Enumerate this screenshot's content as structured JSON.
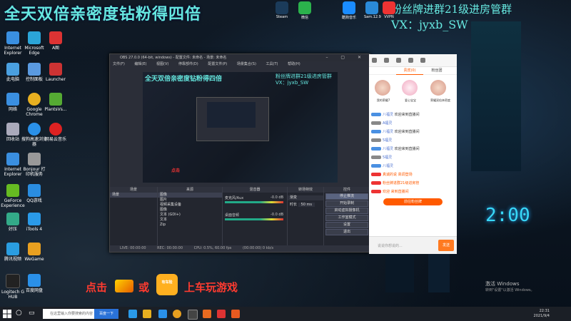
{
  "overlay": {
    "title": "全天双倍亲密度钻粉得四倍",
    "right_line1": "粉丝牌进群21级进房管群",
    "right_line2": "VX：jyxb_SW"
  },
  "top_icons": [
    {
      "label": "Steam",
      "color": "#1b3b5a"
    },
    {
      "label": "微信",
      "color": "#2bb24c"
    },
    {
      "label": "酷狗音乐",
      "color": "#1a8cff"
    },
    {
      "label": "Sam.12.9",
      "color": "#2a8ad8"
    },
    {
      "label": "VVPN",
      "color": "#e33"
    }
  ],
  "desktop_icons": [
    {
      "label": "Internet Explorer",
      "color": "#3a8fe0"
    },
    {
      "label": "Microsoft Edge",
      "color": "#2ba5d8"
    },
    {
      "label": "A图",
      "color": "#d33"
    },
    {
      "label": "此电脑",
      "color": "#4aa0e0"
    },
    {
      "label": "控制面板",
      "color": "#5a9ae0"
    },
    {
      "label": "Launcher",
      "color": "#c33"
    },
    {
      "label": "网络",
      "color": "#3a8fe0"
    },
    {
      "label": "Google Chrome",
      "color": "#e8b020"
    },
    {
      "label": "PlantsVs...",
      "color": "#5a3"
    },
    {
      "label": "回收站",
      "color": "#aab"
    },
    {
      "label": "搜狗高速浏览器",
      "color": "#2a90e8"
    },
    {
      "label": "网易云音乐",
      "color": "#d22"
    },
    {
      "label": "Internet Explorer",
      "color": "#3a8fe0"
    },
    {
      "label": "Bonjour 打印机服务",
      "color": "#999"
    },
    {
      "label": "GeForce Experience",
      "color": "#6b2"
    },
    {
      "label": "QQ游戏",
      "color": "#2a8de0"
    },
    {
      "label": "好压",
      "color": "#3a8"
    },
    {
      "label": "iTools 4",
      "color": "#2a9ae8"
    },
    {
      "label": "腾讯视频",
      "color": "#2a9de0"
    },
    {
      "label": "WeGame",
      "color": "#e8a020"
    },
    {
      "label": "Logitech G HUB",
      "color": "#222"
    },
    {
      "label": "百度网盘",
      "color": "#2a90e8"
    }
  ],
  "obs": {
    "title": "OBS 27.0.0 (64-bit, windows) - 配置文件: 未命名 - 场景: 未命名",
    "menu": [
      "文件(F)",
      "编辑(E)",
      "视图(V)",
      "停靠部件(D)",
      "配置文件(P)",
      "场景集合(S)",
      "工具(T)",
      "帮助(H)"
    ],
    "preview_title": "全天双倍亲密度钻粉得四倍",
    "preview_right1": "粉丝牌进群21级进房管群",
    "preview_right2": "VX：jyxb_SW",
    "preview_red": "点击",
    "panels": {
      "scenes": "场景",
      "sources": "来源",
      "mixer": "混音器",
      "transitions": "转场特效",
      "controls": "控件"
    },
    "scenes_list": [
      "场景"
    ],
    "sources_list": [
      "图像",
      "图片",
      "视频采集设备",
      "图像",
      "文本 (GDI+)",
      "文本",
      "Zip"
    ],
    "mixer": [
      {
        "name": "麦克风/Aux",
        "value": "-0.0 dB"
      },
      {
        "name": "桌面音频",
        "value": "-0.0 dB"
      }
    ],
    "transition_value": "渐变",
    "duration_label": "时长",
    "duration_value": "50 ms",
    "controls": [
      "停止推流",
      "开始录制",
      "启动虚拟摄像机",
      "工作室模式",
      "设置",
      "退出"
    ],
    "status": {
      "live": "LIVE: 00:00:00",
      "rec": "REC: 00:00:00",
      "cpu": "CPU: 0.5%, 60.00 fps",
      "kbps": "(00:00:00) 0 kb/s"
    }
  },
  "chat": {
    "tabs": [
      "",
      "贵宾(0)",
      "粉丝团"
    ],
    "avatar_labels": [
      "我的荣耀7",
      "爱心宝宝",
      "荣耀双倍亲密度"
    ],
    "messages": [
      {
        "name": "八福灵",
        "text": "欢迎来到直播间",
        "sys": false
      },
      {
        "name": "A福灵",
        "text": "",
        "sys": false
      },
      {
        "name": "八福灵",
        "text": "欢迎来到直播间",
        "sys": false
      },
      {
        "name": "5福灵",
        "text": "",
        "sys": false
      },
      {
        "name": "八福灵",
        "text": "欢迎来到直播间",
        "sys": false
      },
      {
        "name": "5福灵",
        "text": "",
        "sys": false
      },
      {
        "name": "八福灵",
        "text": "",
        "sys": false
      },
      {
        "name": "",
        "text": "真诚的说 高调登场",
        "sys": true
      },
      {
        "name": "",
        "text": "粉丝牌进群21级进房管",
        "sys": true
      },
      {
        "name": "",
        "text": "欢迎 来到直播间",
        "sys": true
      }
    ],
    "button": "前往粉丝牌",
    "input_placeholder": "说说你想说的...",
    "send": "发送"
  },
  "promo": {
    "click": "点击",
    "or": "或",
    "cta": "上车玩游戏",
    "app_label": "有车险"
  },
  "clock": "2:00",
  "activate": {
    "line1": "激活 Windows",
    "line2": "转到\"设置\"以激活 Windows。"
  },
  "taskbar": {
    "search_placeholder": "在这里输入你要搜索的内容",
    "search_btn": "百度一下",
    "time": "22:31",
    "date": "2021/9/4"
  }
}
